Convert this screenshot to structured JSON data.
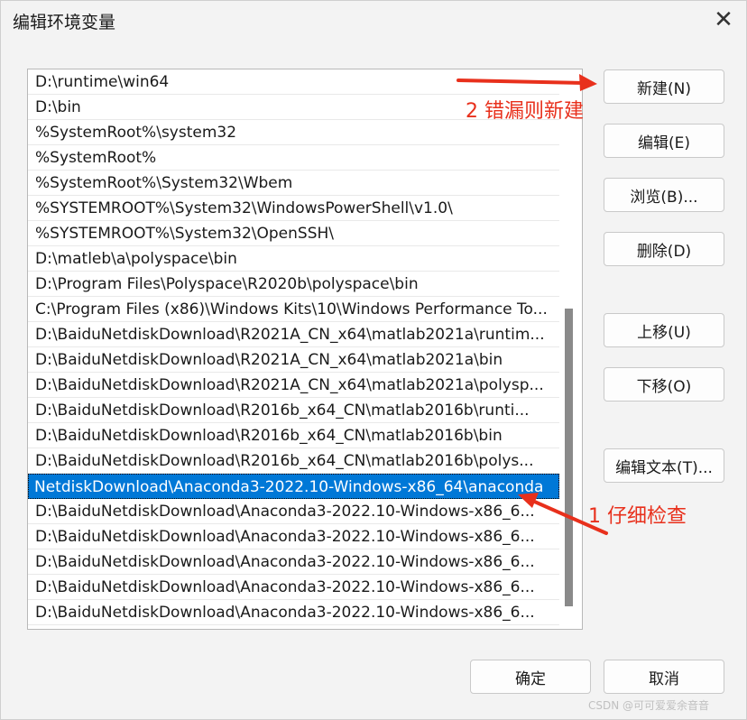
{
  "dialog": {
    "title": "编辑环境变量"
  },
  "path_list": {
    "items": [
      "D:\\runtime\\win64",
      "D:\\bin",
      "%SystemRoot%\\system32",
      "%SystemRoot%",
      "%SystemRoot%\\System32\\Wbem",
      "%SYSTEMROOT%\\System32\\WindowsPowerShell\\v1.0\\",
      "%SYSTEMROOT%\\System32\\OpenSSH\\",
      "D:\\matleb\\a\\polyspace\\bin",
      "D:\\Program Files\\Polyspace\\R2020b\\polyspace\\bin",
      "C:\\Program Files (x86)\\Windows Kits\\10\\Windows Performance To...",
      "D:\\BaiduNetdiskDownload\\R2021A_CN_x64\\matlab2021a\\runtim...",
      "D:\\BaiduNetdiskDownload\\R2021A_CN_x64\\matlab2021a\\bin",
      "D:\\BaiduNetdiskDownload\\R2021A_CN_x64\\matlab2021a\\polysp...",
      "D:\\BaiduNetdiskDownload\\R2016b_x64_CN\\matlab2016b\\runti...",
      "D:\\BaiduNetdiskDownload\\R2016b_x64_CN\\matlab2016b\\bin",
      "D:\\BaiduNetdiskDownload\\R2016b_x64_CN\\matlab2016b\\polys...",
      "NetdiskDownload\\Anaconda3-2022.10-Windows-x86_64\\anaconda",
      "D:\\BaiduNetdiskDownload\\Anaconda3-2022.10-Windows-x86_6...",
      "D:\\BaiduNetdiskDownload\\Anaconda3-2022.10-Windows-x86_6...",
      "D:\\BaiduNetdiskDownload\\Anaconda3-2022.10-Windows-x86_6...",
      "D:\\BaiduNetdiskDownload\\Anaconda3-2022.10-Windows-x86_6...",
      "D:\\BaiduNetdiskDownload\\Anaconda3-2022.10-Windows-x86_6..."
    ],
    "selected_index": 16
  },
  "buttons": {
    "new": "新建(N)",
    "edit": "编辑(E)",
    "browse": "浏览(B)...",
    "delete": "删除(D)",
    "move_up": "上移(U)",
    "move_down": "下移(O)",
    "edit_text": "编辑文本(T)...",
    "ok": "确定",
    "cancel": "取消"
  },
  "annotations": {
    "note_new": "2 错漏则新建",
    "note_check": "1 仔细检查",
    "color": "#e8301c"
  },
  "watermark": "CSDN @可可爱爱余音音",
  "icons": {
    "close": "close-icon"
  }
}
